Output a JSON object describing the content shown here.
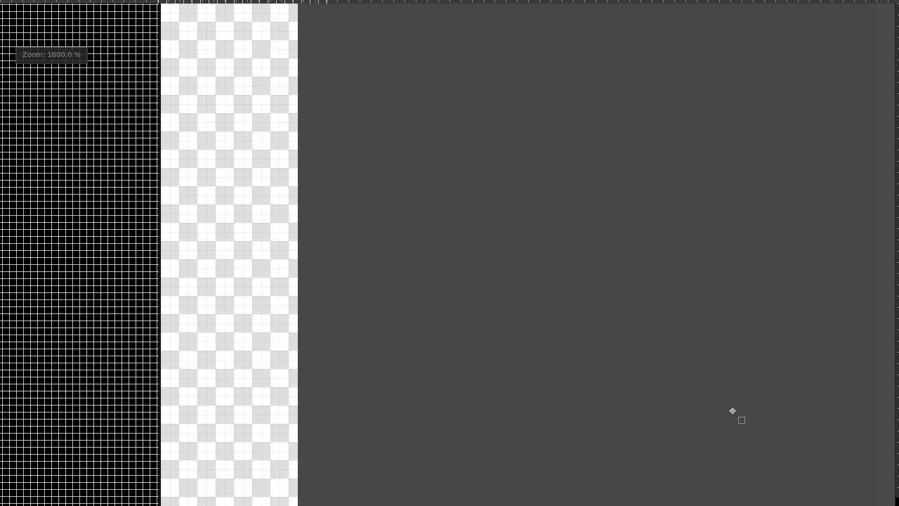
{
  "zoom": {
    "label": "Zoom: 1600.0 %",
    "value_percent": 1600.0
  },
  "cursor": {
    "icon": "move-crosshair-icon",
    "glyph": "✥"
  },
  "colors": {
    "canvas_background": "#474747",
    "grid_background": "#000000",
    "grid_lines": "#ffffff",
    "checker_light": "#ffffff",
    "checker_dark": "#dedede"
  }
}
